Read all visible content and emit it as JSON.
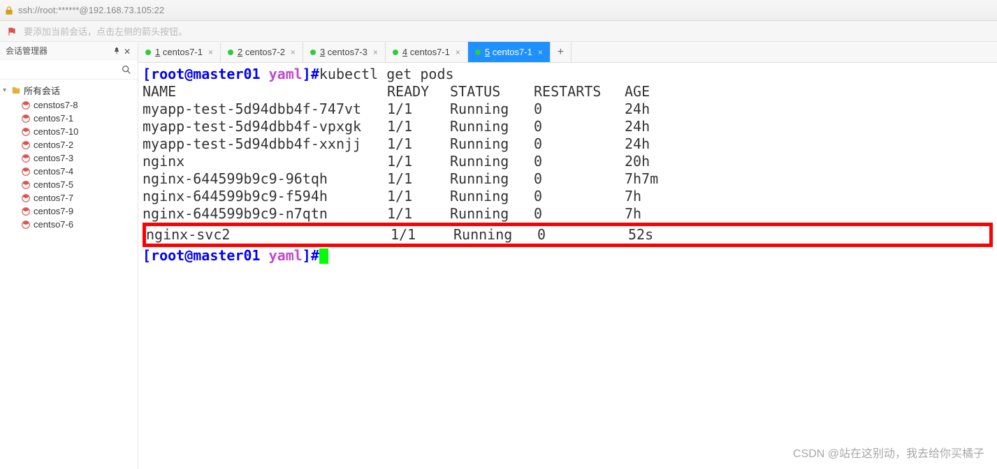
{
  "titlebar": {
    "text": "ssh://root:******@192.168.73.105:22"
  },
  "toolbar": {
    "hint": "要添加当前会话，点击左侧的箭头按钮。"
  },
  "sidebar": {
    "title": "会话管理器",
    "root_label": "所有会话",
    "items": [
      {
        "label": "censtos7-8"
      },
      {
        "label": "centos7-1"
      },
      {
        "label": "centos7-10"
      },
      {
        "label": "centos7-2"
      },
      {
        "label": "centos7-3"
      },
      {
        "label": "centos7-4"
      },
      {
        "label": "centos7-5"
      },
      {
        "label": "centos7-7"
      },
      {
        "label": "centos7-9"
      },
      {
        "label": "centso7-6"
      }
    ]
  },
  "tabs": {
    "items": [
      {
        "num": "1",
        "label": "centos7-1",
        "active": false
      },
      {
        "num": "2",
        "label": "centos7-2",
        "active": false
      },
      {
        "num": "3",
        "label": "centos7-3",
        "active": false
      },
      {
        "num": "4",
        "label": "centos7-1",
        "active": false
      },
      {
        "num": "5",
        "label": "centos7-1",
        "active": true
      }
    ],
    "plus": "+"
  },
  "terminal": {
    "prompt_userhost": "[root@master01 ",
    "prompt_path": "yaml",
    "prompt_end": "]#",
    "command": "kubectl get pods",
    "headers": {
      "name": "NAME",
      "ready": "READY",
      "status": "STATUS",
      "restarts": "RESTARTS",
      "age": "AGE"
    },
    "rows": [
      {
        "name": "myapp-test-5d94dbb4f-747vt",
        "ready": "1/1",
        "status": "Running",
        "restarts": "0",
        "age": "24h",
        "hl": false
      },
      {
        "name": "myapp-test-5d94dbb4f-vpxgk",
        "ready": "1/1",
        "status": "Running",
        "restarts": "0",
        "age": "24h",
        "hl": false
      },
      {
        "name": "myapp-test-5d94dbb4f-xxnjj",
        "ready": "1/1",
        "status": "Running",
        "restarts": "0",
        "age": "24h",
        "hl": false
      },
      {
        "name": "nginx",
        "ready": "1/1",
        "status": "Running",
        "restarts": "0",
        "age": "20h",
        "hl": false
      },
      {
        "name": "nginx-644599b9c9-96tqh",
        "ready": "1/1",
        "status": "Running",
        "restarts": "0",
        "age": "7h7m",
        "hl": false
      },
      {
        "name": "nginx-644599b9c9-f594h",
        "ready": "1/1",
        "status": "Running",
        "restarts": "0",
        "age": "7h",
        "hl": false
      },
      {
        "name": "nginx-644599b9c9-n7qtn",
        "ready": "1/1",
        "status": "Running",
        "restarts": "0",
        "age": "7h",
        "hl": false
      },
      {
        "name": "nginx-svc2",
        "ready": "1/1",
        "status": "Running",
        "restarts": "0",
        "age": "52s",
        "hl": true
      }
    ]
  },
  "watermark": "CSDN @站在这别动，我去给你买橘子"
}
